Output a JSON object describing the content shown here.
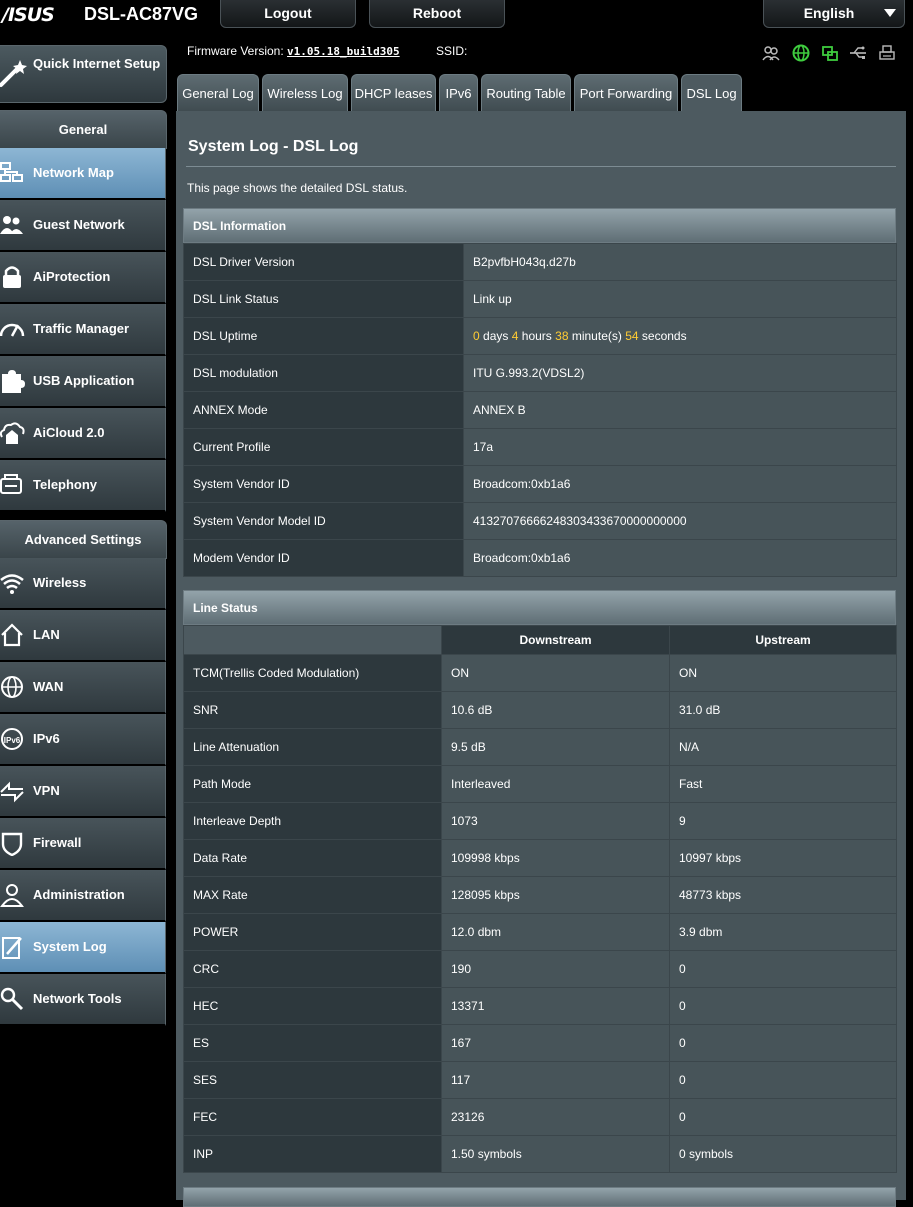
{
  "brand": {
    "logo": "/ISUS",
    "model": "DSL-AC87VG"
  },
  "topbar": {
    "logout": "Logout",
    "reboot": "Reboot",
    "language": "English"
  },
  "status": {
    "fw_label": "Firmware Version:",
    "fw_value": "v1.05.18_build305",
    "ssid_label": "SSID:",
    "icons": [
      "clients-icon",
      "internet-globe-icon",
      "wifi-network-icon",
      "usb-icon",
      "printer-icon"
    ],
    "accent": "#3fcc3f"
  },
  "sidebar": {
    "quick_setup": "Quick Internet Setup",
    "general_head": "General",
    "general": [
      {
        "label": "Network Map",
        "icon": "network-map-icon"
      },
      {
        "label": "Guest Network",
        "icon": "guest-network-icon"
      },
      {
        "label": "AiProtection",
        "icon": "lock-icon"
      },
      {
        "label": "Traffic Manager",
        "icon": "speedometer-icon"
      },
      {
        "label": "USB Application",
        "icon": "puzzle-icon"
      },
      {
        "label": "AiCloud 2.0",
        "icon": "cloud-house-icon"
      },
      {
        "label": "Telephony",
        "icon": "phone-icon"
      }
    ],
    "advanced_head": "Advanced Settings",
    "advanced": [
      {
        "label": "Wireless",
        "icon": "wifi-icon"
      },
      {
        "label": "LAN",
        "icon": "house-icon"
      },
      {
        "label": "WAN",
        "icon": "globe-icon"
      },
      {
        "label": "IPv6",
        "icon": "ipv6-globe-icon"
      },
      {
        "label": "VPN",
        "icon": "vpn-icon"
      },
      {
        "label": "Firewall",
        "icon": "shield-icon"
      },
      {
        "label": "Administration",
        "icon": "admin-person-icon"
      },
      {
        "label": "System Log",
        "icon": "notepad-icon"
      },
      {
        "label": "Network Tools",
        "icon": "search-tools-icon"
      }
    ]
  },
  "tabs": [
    "General Log",
    "Wireless Log",
    "DHCP leases",
    "IPv6",
    "Routing Table",
    "Port Forwarding",
    "DSL Log"
  ],
  "page": {
    "title": "System Log - DSL Log",
    "description": "This page shows the detailed DSL status."
  },
  "dsl_info": {
    "heading": "DSL Information",
    "rows": [
      {
        "k": "DSL Driver Version",
        "v": "B2pvfbH043q.d27b"
      },
      {
        "k": "DSL Link Status",
        "v": "Link up"
      },
      {
        "k": "DSL Uptime",
        "v": ""
      },
      {
        "k": "DSL modulation",
        "v": "ITU G.993.2(VDSL2)"
      },
      {
        "k": "ANNEX Mode",
        "v": "ANNEX B"
      },
      {
        "k": "Current Profile",
        "v": "17a"
      },
      {
        "k": "System Vendor ID",
        "v": "Broadcom:0xb1a6"
      },
      {
        "k": "System Vendor Model ID",
        "v": "41327076666248303433670000000000"
      },
      {
        "k": "Modem Vendor ID",
        "v": "Broadcom:0xb1a6"
      }
    ],
    "uptime": {
      "days": "0",
      "days_unit": "days",
      "hours": "4",
      "hours_unit": "hours",
      "minutes": "38",
      "minutes_unit": "minute(s)",
      "seconds": "54",
      "seconds_unit": "seconds"
    }
  },
  "line_status": {
    "heading": "Line Status",
    "columns": [
      "Downstream",
      "Upstream"
    ],
    "rows": [
      {
        "k": "TCM(Trellis Coded Modulation)",
        "d": "ON",
        "u": "ON"
      },
      {
        "k": "SNR",
        "d": "10.6 dB",
        "u": "31.0 dB"
      },
      {
        "k": "Line Attenuation",
        "d": "9.5 dB",
        "u": "N/A"
      },
      {
        "k": "Path Mode",
        "d": "Interleaved",
        "u": "Fast"
      },
      {
        "k": "Interleave Depth",
        "d": "1073",
        "u": "9"
      },
      {
        "k": "Data Rate",
        "d": "109998 kbps",
        "u": "10997 kbps"
      },
      {
        "k": "MAX Rate",
        "d": "128095 kbps",
        "u": "48773 kbps"
      },
      {
        "k": "POWER",
        "d": "12.0 dbm",
        "u": "3.9 dbm"
      },
      {
        "k": "CRC",
        "d": "190",
        "u": "0"
      },
      {
        "k": "HEC",
        "d": "13371",
        "u": "0"
      },
      {
        "k": "ES",
        "d": "167",
        "u": "0"
      },
      {
        "k": "SES",
        "d": "117",
        "u": "0"
      },
      {
        "k": "FEC",
        "d": "23126",
        "u": "0"
      },
      {
        "k": "INP",
        "d": "1.50 symbols",
        "u": "0 symbols"
      }
    ]
  }
}
